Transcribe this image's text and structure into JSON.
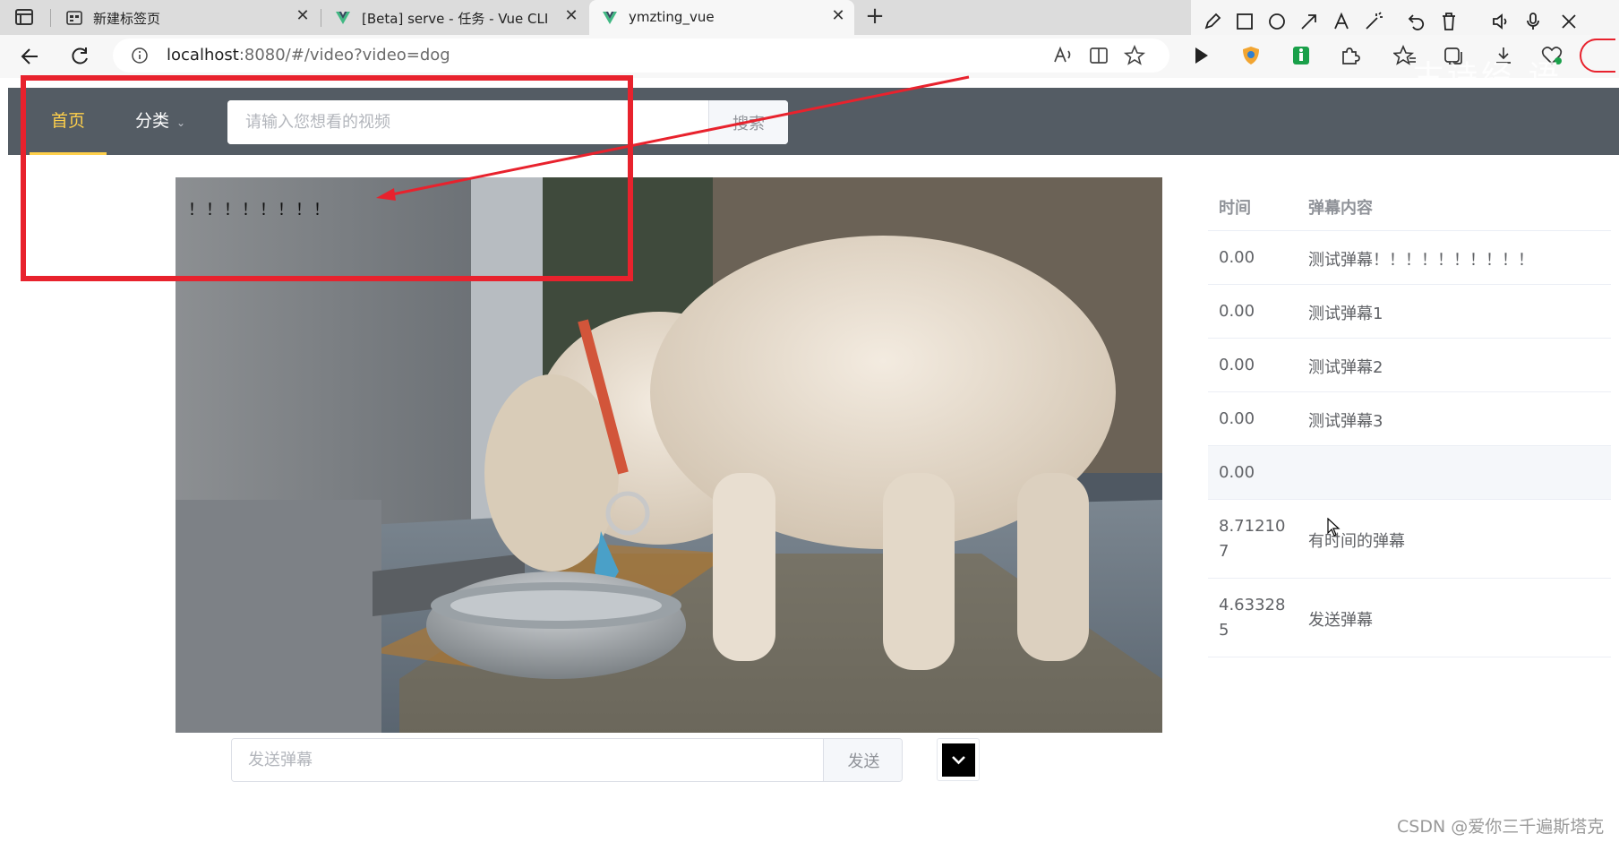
{
  "browser": {
    "tabs": [
      {
        "title": "新建标签页",
        "icon": "new-tab-page-icon",
        "active": false
      },
      {
        "title": "[Beta] serve - 任务 - Vue CLI",
        "icon": "vue-logo-icon",
        "active": false
      },
      {
        "title": "ymzting_vue",
        "icon": "vue-logo-icon",
        "active": true
      }
    ],
    "url_host": "localhost",
    "url_rest": ":8080/#/video?video=dog",
    "overlay_text": "古诗经 语"
  },
  "nav": {
    "home": "首页",
    "category": "分类",
    "search_placeholder": "请输入您想看的视频",
    "search_button": "搜索"
  },
  "video": {
    "danmaku_text": "！！！！！！！！",
    "image": "poodle dog eating from a metal bowl"
  },
  "send": {
    "placeholder": "发送弹幕",
    "button": "发送"
  },
  "table": {
    "headers": {
      "time": "时间",
      "content": "弹幕内容"
    },
    "rows": [
      {
        "time": "0.00",
        "text": "测试弹幕！！！！！！！！！！"
      },
      {
        "time": "0.00",
        "text": "测试弹幕1"
      },
      {
        "time": "0.00",
        "text": "测试弹幕2"
      },
      {
        "time": "0.00",
        "text": "测试弹幕3"
      },
      {
        "time": "0.00",
        "text": ""
      },
      {
        "time": "8.712107",
        "text": "有时间的弹幕"
      },
      {
        "time": "4.633285",
        "text": "发送弹幕"
      }
    ]
  },
  "colors": {
    "header_bg": "#545c64",
    "active_menu": "#ffd04b",
    "annotation": "#e8222d"
  },
  "watermark": "CSDN @爱你三千遍斯塔克"
}
